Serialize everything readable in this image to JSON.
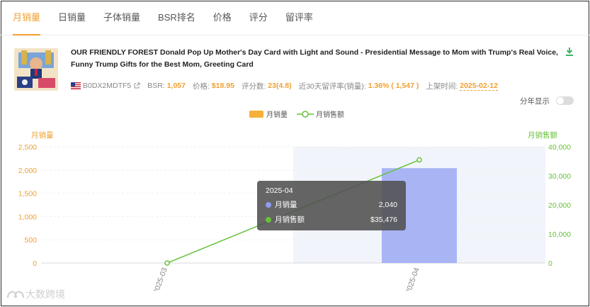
{
  "tabs": [
    {
      "label": "月销量",
      "active": true
    },
    {
      "label": "日销量",
      "active": false
    },
    {
      "label": "子体销量",
      "active": false
    },
    {
      "label": "BSR排名",
      "active": false
    },
    {
      "label": "价格",
      "active": false
    },
    {
      "label": "评分",
      "active": false
    },
    {
      "label": "留评率",
      "active": false
    }
  ],
  "product": {
    "title": "OUR FRIENDLY FOREST Donald Pop Up Mother's Day Card with Light and Sound - Presidential Message to Mom with Trump's Real Voice, Funny Trump Gifts for the Best Mom, Greeting Card",
    "asin": "B0DX2MDTF5",
    "bsr_label": "BSR:",
    "bsr_value": "1,057",
    "price_label": "价格:",
    "price_value": "$18.95",
    "rating_label": "评分数:",
    "rating_value": "23(4.8)",
    "review_rate_label": "近30天留评率(销量):",
    "review_rate_value": "1.36% ( 1,547 )",
    "listing_label": "上架时间:",
    "listing_value": "2025-02-12"
  },
  "toggle": {
    "label": "分年显示",
    "on": false
  },
  "colors": {
    "accent": "#f0a030",
    "bar": "#a9b4f5",
    "line": "#67c23a",
    "bar_legend": "#f5b03a"
  },
  "tooltip": {
    "title": "2025-04",
    "rows": [
      {
        "label": "月销量",
        "value": "2,040",
        "color": "#8f9cf2"
      },
      {
        "label": "月销售额",
        "value": "$35,476",
        "color": "#67c23a"
      }
    ]
  },
  "watermark": "大数跨境",
  "chart_data": {
    "type": "bar",
    "categories": [
      "2025-03",
      "2025-04"
    ],
    "series": [
      {
        "name": "月销量",
        "type": "bar",
        "axis": "left",
        "values": [
          0,
          2040
        ]
      },
      {
        "name": "月销售额",
        "type": "line",
        "axis": "right",
        "values": [
          0,
          35476
        ]
      }
    ],
    "ylabel": "月销量",
    "y2label": "月销售额",
    "ylim": [
      0,
      2500
    ],
    "y2lim": [
      0,
      40000
    ],
    "yticks": [
      "0",
      "500",
      "1,000",
      "1,500",
      "2,000",
      "2,500"
    ],
    "y2ticks": [
      "0",
      "10,000",
      "20,000",
      "30,000",
      "40,000"
    ],
    "legend": "top-center",
    "highlighted_category": "2025-04"
  }
}
